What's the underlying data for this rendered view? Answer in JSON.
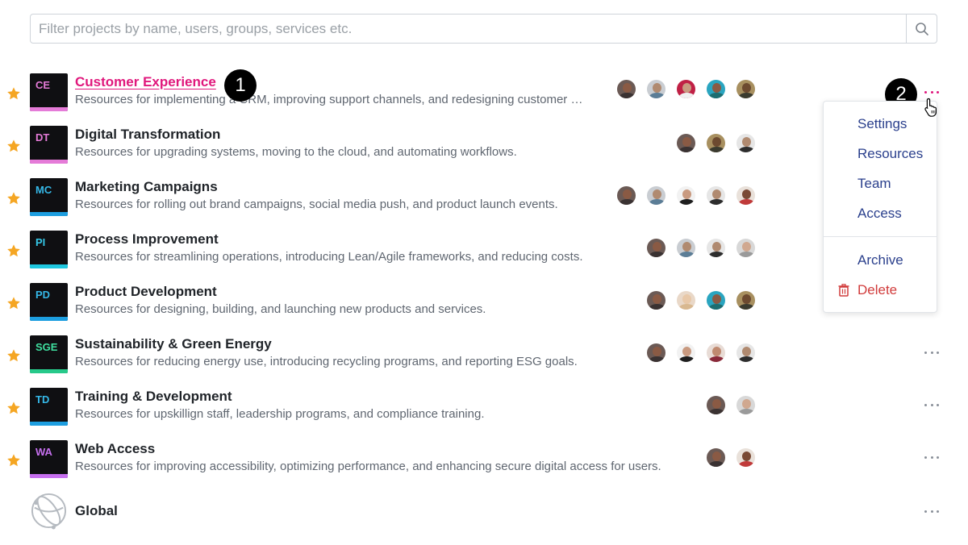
{
  "search": {
    "placeholder": "Filter projects by name, users, groups, services etc.",
    "icon": "search-icon"
  },
  "projects": [
    {
      "code": "CE",
      "code_color": "#e57bd8",
      "bar_color": "#e57bd8",
      "title": "Customer Experience",
      "description": "Resources for implementing a CRM, improving support channels, and redesigning customer to...",
      "starred": true,
      "avatar_count": 5
    },
    {
      "code": "DT",
      "code_color": "#e57bd8",
      "bar_color": "#e57bd8",
      "title": "Digital Transformation",
      "description": "Resources for upgrading systems, moving to the cloud, and automating workflows.",
      "starred": true,
      "avatar_count": 3
    },
    {
      "code": "MC",
      "code_color": "#35b8e8",
      "bar_color": "#1d9ee0",
      "title": "Marketing Campaigns",
      "description": "Resources for rolling out brand campaigns, social media push, and product launch events.",
      "starred": true,
      "avatar_count": 5
    },
    {
      "code": "PI",
      "code_color": "#35c8e8",
      "bar_color": "#1fc8e0",
      "title": "Process Improvement",
      "description": "Resources for streamlining operations, introducing Lean/Agile frameworks, and reducing costs.",
      "starred": true,
      "avatar_count": 4
    },
    {
      "code": "PD",
      "code_color": "#35b8e8",
      "bar_color": "#1d9ee0",
      "title": "Product Development",
      "description": "Resources for designing, building, and launching new products and services.",
      "starred": true,
      "avatar_count": 4
    },
    {
      "code": "SGE",
      "code_color": "#3fe0a0",
      "bar_color": "#27c98a",
      "title": "Sustainability & Green Energy",
      "description": "Resources for reducing energy use, introducing recycling programs, and reporting ESG goals.",
      "starred": true,
      "avatar_count": 4
    },
    {
      "code": "TD",
      "code_color": "#35b8e8",
      "bar_color": "#1d9ee0",
      "title": "Training & Development",
      "description": "Resources for upskillign staff, leadership programs, and compliance training.",
      "starred": true,
      "avatar_count": 2
    },
    {
      "code": "WA",
      "code_color": "#c770f0",
      "bar_color": "#c770f0",
      "title": "Web Access",
      "description": "Resources for improving accessibility, optimizing performance, and enhancing secure digital access for users.",
      "starred": true,
      "avatar_count": 2
    }
  ],
  "global": {
    "title": "Global",
    "icon": "globe-icon"
  },
  "markers": {
    "first": "1",
    "second": "2"
  },
  "menu": {
    "items": [
      "Settings",
      "Resources",
      "Team",
      "Access"
    ],
    "archive": "Archive",
    "delete": "Delete"
  },
  "colors": {
    "accent": "#e0177c",
    "star": "#f5a623",
    "menu_text": "#2a3f8c",
    "danger": "#d13b3b"
  }
}
